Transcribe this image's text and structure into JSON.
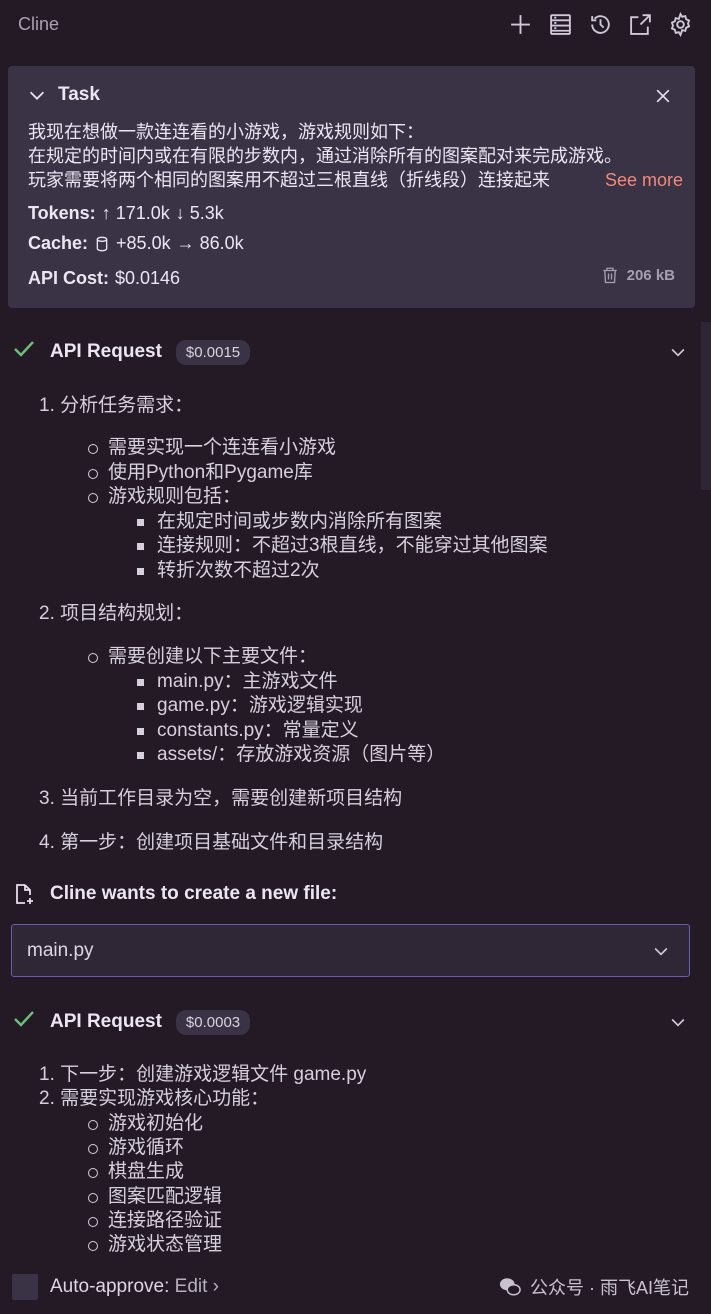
{
  "app": {
    "title": "Cline"
  },
  "toolbar": {
    "icons": [
      "plus-icon",
      "server-icon",
      "history-icon",
      "popout-icon",
      "gear-icon"
    ]
  },
  "task": {
    "title": "Task",
    "text_lines": [
      "我现在想做一款连连看的小游戏，游戏规则如下：",
      "在规定的时间内或在有限的步数内，通过消除所有的图案配对来完成游戏。",
      "玩家需要将两个相同的图案用不超过三根直线（折线段）连接起来"
    ],
    "see_more": "See more",
    "tokens_label": "Tokens:",
    "tokens_in": "↑ 171.0k",
    "tokens_out": "↓ 5.3k",
    "cache_label": "Cache:",
    "cache_write": "+85.0k",
    "cache_read": "→ 86.0k",
    "api_cost_label": "API Cost:",
    "api_cost_value": "$0.0146",
    "size": "206 kB"
  },
  "request1": {
    "label": "API Request",
    "cost": "$0.0015",
    "items": {
      "ol1": "1. 分析任务需求：",
      "ul1": "需要实现一个连连看小游戏",
      "ul2": "使用Python和Pygame库",
      "ul3": "游戏规则包括：",
      "sq1": "在规定时间或步数内消除所有图案",
      "sq2": "连接规则：不超过3根直线，不能穿过其他图案",
      "sq3": "转折次数不超过2次",
      "ol2": "2. 项目结构规划：",
      "ul4": "需要创建以下主要文件：",
      "sq4": "main.py：主游戏文件",
      "sq5": "game.py：游戏逻辑实现",
      "sq6": "constants.py：常量定义",
      "sq7": "assets/：存放游戏资源（图片等）",
      "ol3": "3. 当前工作目录为空，需要创建新项目结构",
      "ol4": "4. 第一步：创建项目基础文件和目录结构"
    }
  },
  "create_file": {
    "label": "Cline wants to create a new file:",
    "filename": "main.py"
  },
  "request2": {
    "label": "API Request",
    "cost": "$0.0003",
    "items": {
      "ol1": "1. 下一步：创建游戏逻辑文件 game.py",
      "ol2": "2. 需要实现游戏核心功能：",
      "ul1": "游戏初始化",
      "ul2": "游戏循环",
      "ul3": "棋盘生成",
      "ul4": "图案匹配逻辑",
      "ul5": "连接路径验证",
      "ul6": "游戏状态管理"
    }
  },
  "footer": {
    "auto_approve": "Auto-approve:",
    "edit": "Edit",
    "chevron": "›",
    "watermark": "公众号 · 雨飞AI笔记"
  }
}
